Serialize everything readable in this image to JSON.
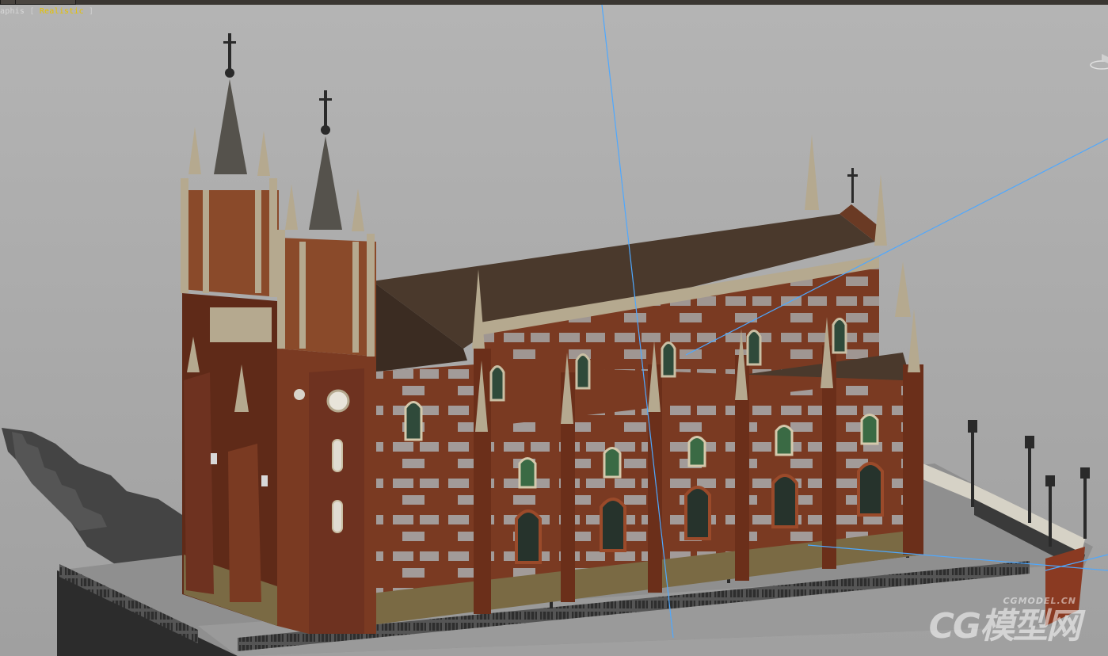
{
  "viewport": {
    "label_prefix": "aphis",
    "open_bracket": "[",
    "shading_mode": "Realistic",
    "close_bracket": "]"
  },
  "watermark": {
    "brand_big": "CG模型网",
    "brand_small": "CGMODEL.CN"
  },
  "colors": {
    "background": "#8c8c8c",
    "ground": "#9e9e9e",
    "brick": "#7a3a22",
    "stone": "#b5a98f",
    "roof": "#4a392c",
    "spire": "#55524c",
    "guide_line": "#4ea8ff",
    "mode_label": "#e6c200"
  },
  "icons": {
    "viewcube": "viewcube-icon"
  }
}
